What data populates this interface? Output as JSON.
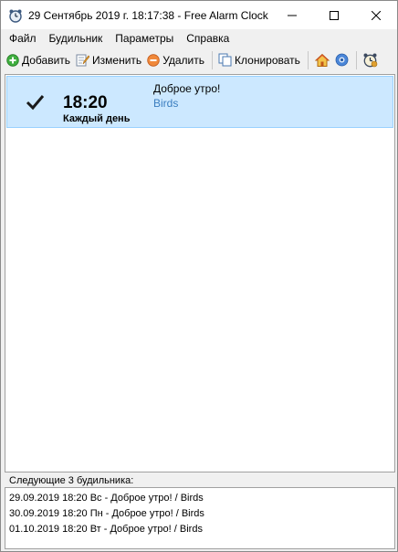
{
  "window": {
    "title": "29 Сентябрь 2019 г. 18:17:38 - Free Alarm Clock"
  },
  "menu": {
    "items": [
      {
        "label": "Файл"
      },
      {
        "label": "Будильник"
      },
      {
        "label": "Параметры"
      },
      {
        "label": "Справка"
      }
    ]
  },
  "toolbar": {
    "add_label": "Добавить",
    "edit_label": "Изменить",
    "delete_label": "Удалить",
    "clone_label": "Клонировать",
    "icons": [
      "home-icon",
      "help-icon",
      "alarm-clock-icon"
    ]
  },
  "alarms": [
    {
      "enabled": true,
      "time": "18:20",
      "repeat": "Каждый день",
      "label": "Доброе утро!",
      "sound": "Birds"
    }
  ],
  "next_alarms": {
    "title": "Следующие 3 будильника:",
    "items": [
      "29.09.2019 18:20 Вс - Доброе утро! / Birds",
      "30.09.2019 18:20 Пн - Доброе утро! / Birds",
      "01.10.2019 18:20 Вт - Доброе утро! / Birds"
    ]
  },
  "colors": {
    "selected_row": "#cce8ff",
    "sound_text": "#3a7dbf"
  }
}
